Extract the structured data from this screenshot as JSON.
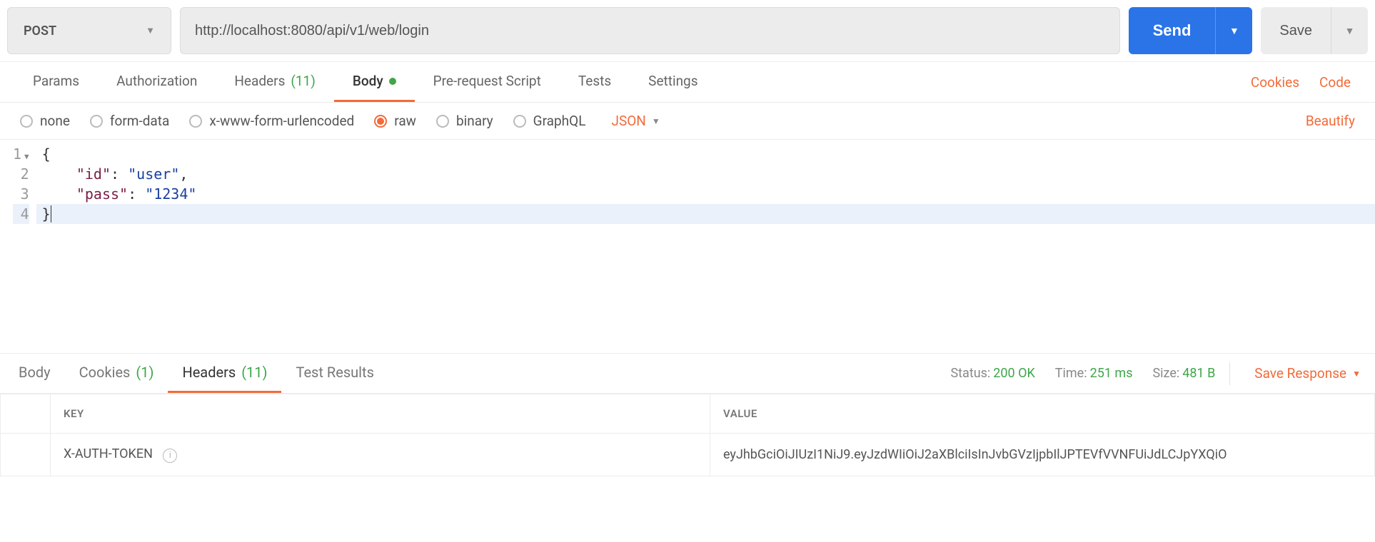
{
  "request": {
    "method": "POST",
    "url": "http://localhost:8080/api/v1/web/login",
    "send_label": "Send",
    "save_label": "Save"
  },
  "req_tabs": {
    "params": "Params",
    "authorization": "Authorization",
    "headers": "Headers",
    "headers_count": "(11)",
    "body": "Body",
    "prerequest": "Pre-request Script",
    "tests": "Tests",
    "settings": "Settings",
    "cookies_link": "Cookies",
    "code_link": "Code"
  },
  "body_types": {
    "none": "none",
    "formdata": "form-data",
    "urlencoded": "x-www-form-urlencoded",
    "raw": "raw",
    "binary": "binary",
    "graphql": "GraphQL",
    "format": "JSON",
    "beautify": "Beautify"
  },
  "editor": {
    "lines": [
      "1",
      "2",
      "3",
      "4"
    ],
    "l1_brace": "{",
    "l2_key": "\"id\"",
    "l2_colon": ": ",
    "l2_val": "\"user\"",
    "l2_comma": ",",
    "l3_key": "\"pass\"",
    "l3_colon": ": ",
    "l3_val": "\"1234\"",
    "l4_brace": "}"
  },
  "resp_tabs": {
    "body": "Body",
    "cookies": "Cookies",
    "cookies_count": "(1)",
    "headers": "Headers",
    "headers_count": "(11)",
    "test_results": "Test Results"
  },
  "resp_meta": {
    "status_lbl": "Status:",
    "status_val": "200 OK",
    "time_lbl": "Time:",
    "time_val": "251 ms",
    "size_lbl": "Size:",
    "size_val": "481 B",
    "save_response": "Save Response"
  },
  "resp_headers_table": {
    "col_key": "KEY",
    "col_value": "VALUE",
    "rows": [
      {
        "key": "X-AUTH-TOKEN",
        "value": "eyJhbGciOiJIUzI1NiJ9.eyJzdWIiOiJ2aXBlciIsInJvbGVzIjpbIlJPTEVfVVNFUiJdLCJpYXQiO"
      }
    ]
  }
}
